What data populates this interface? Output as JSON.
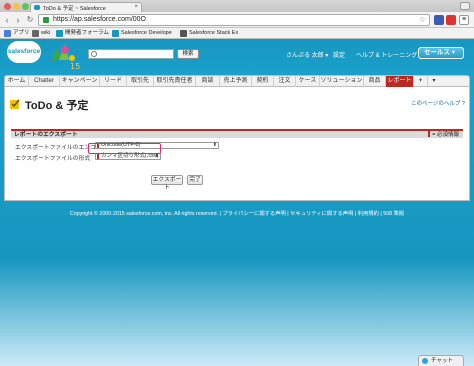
{
  "browser": {
    "tab_title": "ToDo & 予定 ~ Salesforce",
    "tab_close": "×",
    "url": "https://ap.salesforce.com/00O",
    "nav_back": "‹",
    "nav_forward": "›",
    "nav_reload": "↻",
    "bookmark_star": "☆",
    "bookmarks": [
      "アプリ",
      "wiki",
      "開発者フォーラム",
      "Salesforce Develope",
      "Salesforce Stack Ex"
    ]
  },
  "header": {
    "logo_text": "salesforce",
    "search_button": "検索",
    "user_menu": "さんぷる 太郎 ▾",
    "setup_link": "設定",
    "help_link": "ヘルプ & トレーニング",
    "app_menu": "セールス ▾"
  },
  "tabs": [
    {
      "label": "ホーム",
      "active": false
    },
    {
      "label": "Chatter",
      "active": false
    },
    {
      "label": "キャンペーン",
      "active": false
    },
    {
      "label": "リード",
      "active": false
    },
    {
      "label": "取引先",
      "active": false
    },
    {
      "label": "取引先責任者",
      "active": false
    },
    {
      "label": "商談",
      "active": false
    },
    {
      "label": "売上予測",
      "active": false
    },
    {
      "label": "契約",
      "active": false
    },
    {
      "label": "注文",
      "active": false
    },
    {
      "label": "ケース",
      "active": false
    },
    {
      "label": "ソリューション",
      "active": false
    },
    {
      "label": "商品",
      "active": false
    },
    {
      "label": "レポート",
      "active": true
    },
    {
      "label": "+",
      "active": false
    },
    {
      "label": "▾",
      "active": false
    }
  ],
  "page": {
    "title": "ToDo & 予定",
    "help_text": "このページのヘルプ ?"
  },
  "section": {
    "title": "レポートのエクスポート",
    "required_legend": "= 必須情報"
  },
  "form": {
    "encoding_label": "エクスポートファイルのエンコード",
    "encoding_value": "Unicode(UTF-8)",
    "format_label": "エクスポートファイルの形式",
    "format_value": "カンマ区切り形式(.csv)",
    "select_caret": "⬍"
  },
  "buttons": {
    "export": "エクスポート",
    "done": "完了"
  },
  "footer": {
    "text": "Copyright © 2000-2015 salesforce.com, inc. All rights reserved. | プライバシーに関する声明 | セキュリティに関する声明 | 利用規約 | 508 準拠"
  },
  "chat": {
    "label": "チャット"
  },
  "colors": {
    "brand_blue": "#1798c1",
    "active_tab_red": "#b92b22",
    "highlight_pink": "#e0267d"
  }
}
